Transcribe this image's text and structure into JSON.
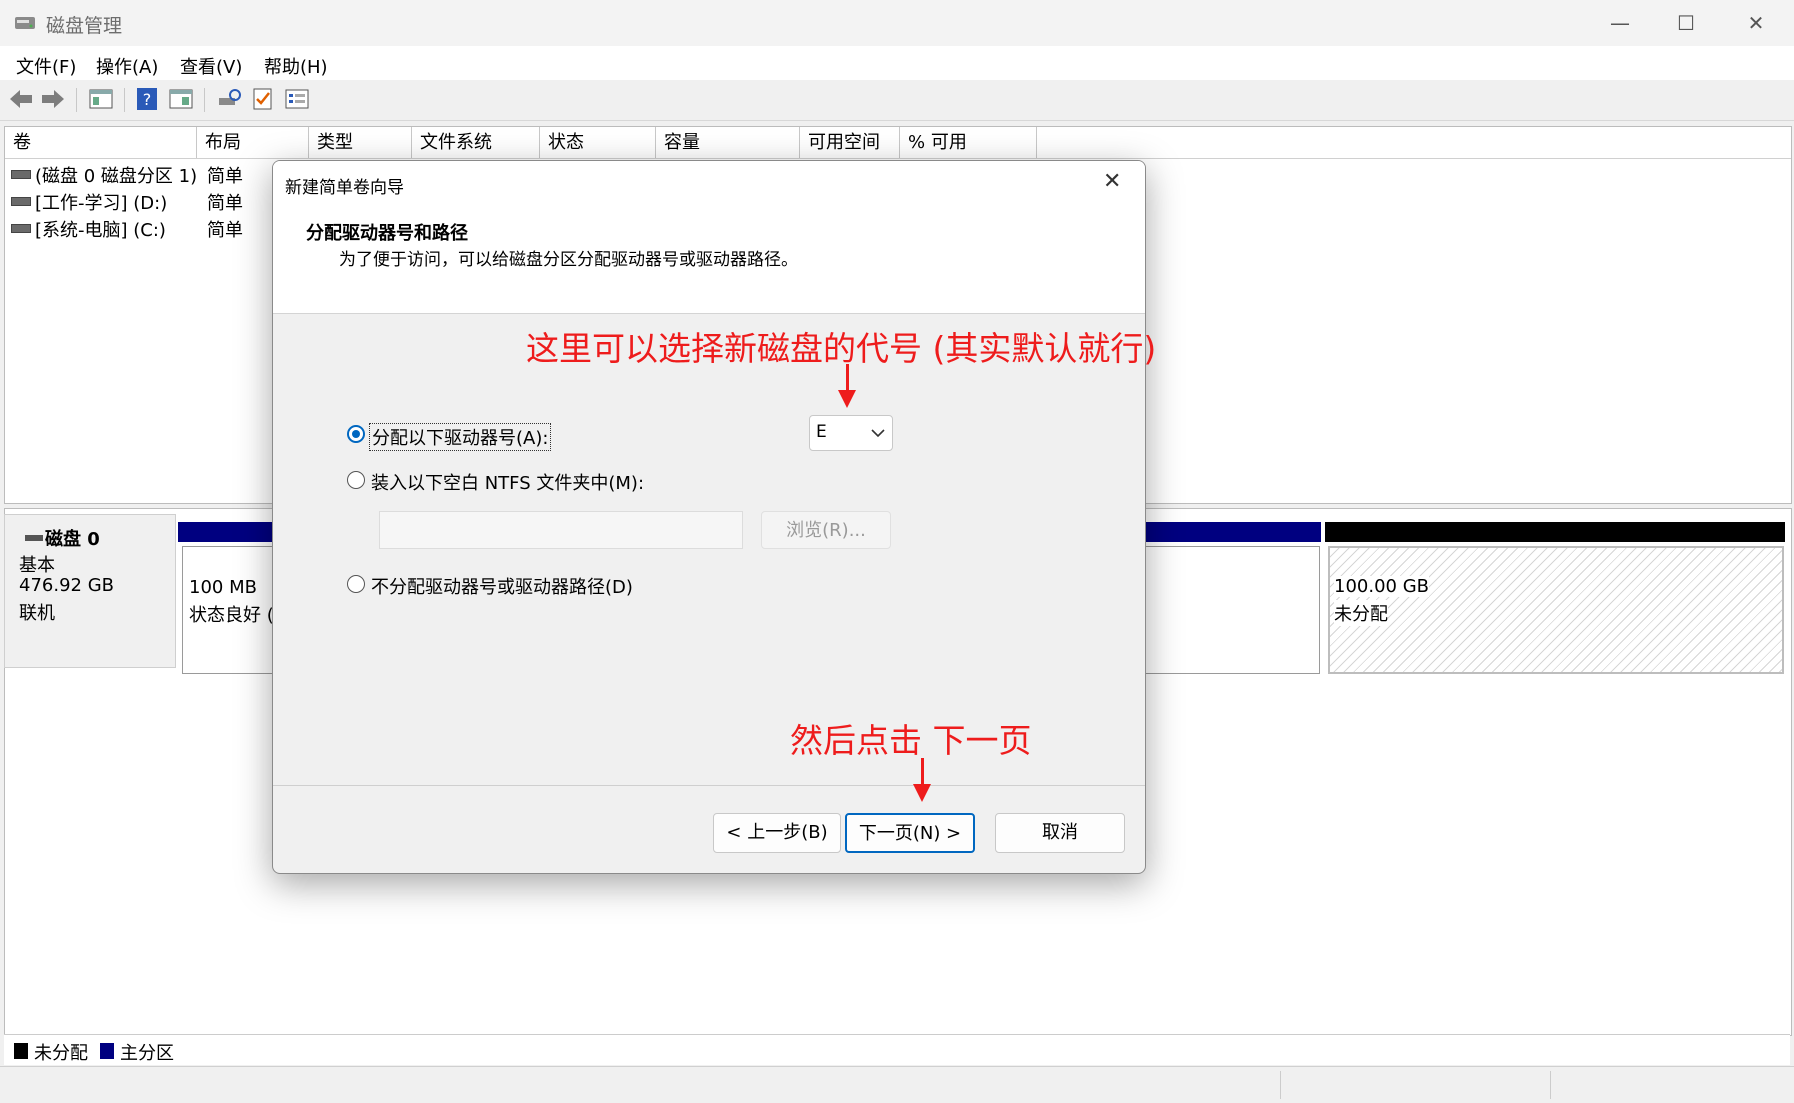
{
  "window": {
    "title": "磁盘管理",
    "minimize": "—",
    "maximize": "☐",
    "close": "✕"
  },
  "menu": [
    "文件(F)",
    "操作(A)",
    "查看(V)",
    "帮助(H)"
  ],
  "volume_table": {
    "columns": [
      "卷",
      "布局",
      "类型",
      "文件系统",
      "状态",
      "容量",
      "可用空间",
      "% 可用"
    ],
    "rows": [
      {
        "name": "(磁盘 0 磁盘分区 1)",
        "layout": "简单"
      },
      {
        "name": "[工作-学习] (D:)",
        "layout": "简单"
      },
      {
        "name": "[系统-电脑] (C:)",
        "layout": "简单"
      }
    ]
  },
  "disk": {
    "name": "磁盘 0",
    "type": "基本",
    "size": "476.92 GB",
    "state": "联机",
    "partitions": [
      {
        "size": "100 MB",
        "status": "状态良好 (",
        "color": "#000080"
      },
      {
        "size": "100.00 GB",
        "status": "未分配",
        "color": "#000000"
      }
    ]
  },
  "legend": [
    {
      "label": "未分配",
      "color": "#000000"
    },
    {
      "label": "主分区",
      "color": "#000080"
    }
  ],
  "dialog": {
    "title": "新建简单卷向导",
    "close": "✕",
    "heading": "分配驱动器号和路径",
    "description": "为了便于访问，可以给磁盘分区分配驱动器号或驱动器路径。",
    "option_assign": "分配以下驱动器号(A):",
    "drive_letter": "E",
    "option_mount": "装入以下空白 NTFS 文件夹中(M):",
    "browse": "浏览(R)...",
    "option_none": "不分配驱动器号或驱动器路径(D)",
    "back": "< 上一步(B)",
    "next": "下一页(N) >",
    "cancel": "取消"
  },
  "annotations": {
    "top": "这里可以选择新磁盘的代号 (其实默认就行)",
    "bottom": "然后点击 下一页"
  }
}
